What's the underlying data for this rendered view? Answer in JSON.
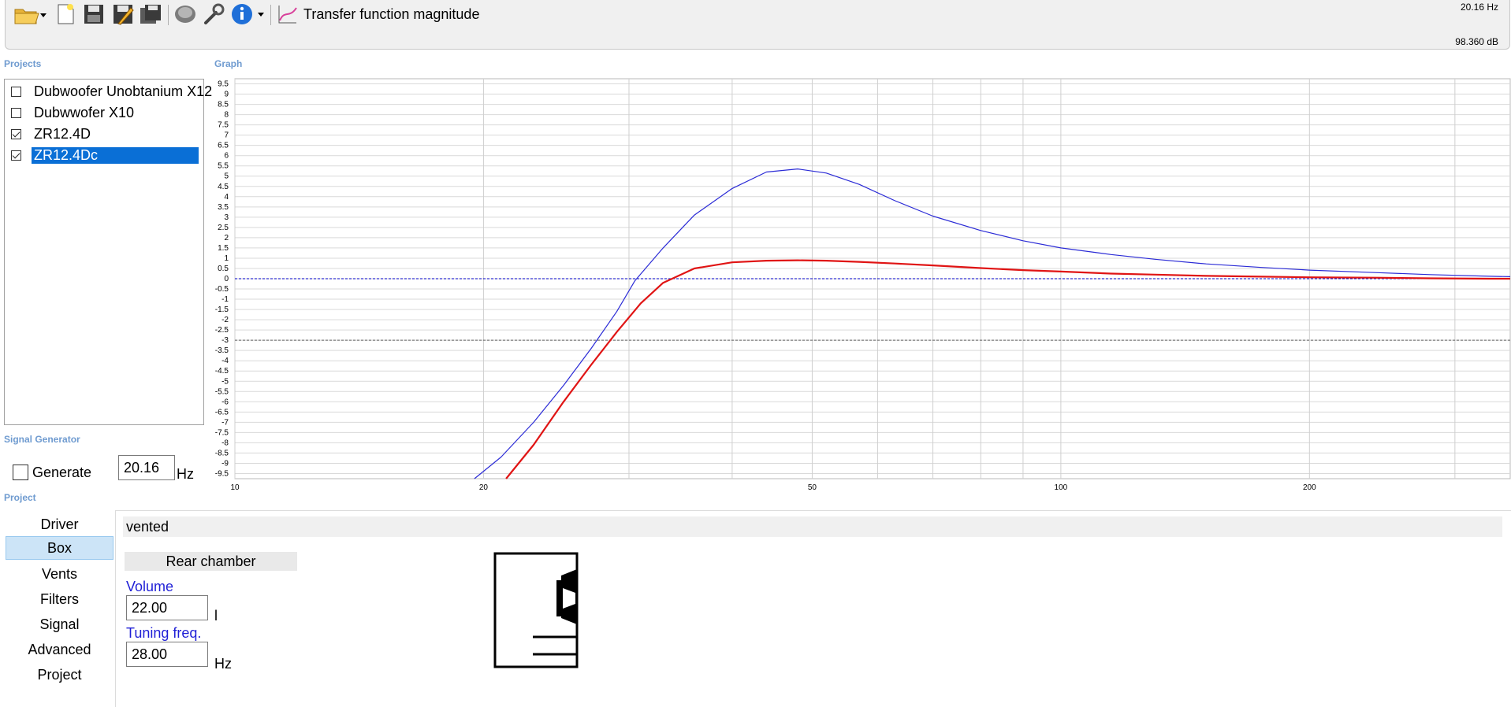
{
  "toolbar": {
    "buttons": [
      {
        "name": "open-folder-icon",
        "dropdown": true
      },
      {
        "name": "new-file-icon"
      },
      {
        "name": "save-icon"
      },
      {
        "name": "save-as-icon"
      },
      {
        "name": "save-all-icon"
      },
      {
        "name": "speaker-icon"
      },
      {
        "name": "wrench-icon"
      },
      {
        "name": "info-icon",
        "dropdown": true
      },
      {
        "name": "chart-icon"
      }
    ],
    "chart_title": "Transfer function magnitude",
    "freq_readout": "20.16 Hz",
    "db_readout": "98.360 dB"
  },
  "projects": {
    "title": "Projects",
    "items": [
      {
        "label": "Dubwoofer Unobtanium X12",
        "checked": false,
        "selected": false
      },
      {
        "label": "Dubwwofer X10",
        "checked": false,
        "selected": false
      },
      {
        "label": "ZR12.4D",
        "checked": true,
        "selected": false
      },
      {
        "label": "ZR12.4Dc",
        "checked": true,
        "selected": true
      }
    ]
  },
  "graph": {
    "title": "Graph"
  },
  "signal_generator": {
    "title": "Signal Generator",
    "generate_label": "Generate",
    "generate_checked": false,
    "frequency_value": "20.16",
    "frequency_unit": "Hz"
  },
  "project": {
    "title": "Project",
    "nav": [
      "Driver",
      "Box",
      "Vents",
      "Filters",
      "Signal",
      "Advanced",
      "Project"
    ],
    "selected_nav": "Box",
    "box_type": "vented",
    "rear_chamber_label": "Rear chamber",
    "volume_label": "Volume",
    "volume_value": "22.00",
    "volume_unit": "l",
    "tuning_label": "Tuning freq.",
    "tuning_value": "28.00",
    "tuning_unit": "Hz"
  },
  "chart_data": {
    "type": "line",
    "title": "",
    "xlabel": "",
    "ylabel": "",
    "x_scale": "log",
    "xlim": [
      10,
      350
    ],
    "ylim": [
      -9.75,
      9.75
    ],
    "x_tick_labels": [
      "10",
      "20",
      "50",
      "100",
      "200"
    ],
    "x_ticks": [
      10,
      20,
      50,
      100,
      200
    ],
    "y_ticks": [
      9.5,
      9,
      8.5,
      8,
      7.5,
      7,
      6.5,
      6,
      5.5,
      5,
      4.5,
      4,
      3.5,
      3,
      2.5,
      2,
      1.5,
      1,
      0.5,
      0,
      -0.5,
      -1,
      -1.5,
      -2,
      -2.5,
      -3,
      -3.5,
      -4,
      -4.5,
      -5,
      -5.5,
      -6,
      -6.5,
      -7,
      -7.5,
      -8,
      -8.5,
      -9,
      -9.5
    ],
    "y_tick_labels": [
      "9.5",
      "9",
      "8.5",
      "8",
      "7.5",
      "7",
      "6.5",
      "6",
      "5.5",
      "5",
      "4.5",
      "4",
      "3.5",
      "3",
      "2.5",
      "2",
      "1.5",
      "1",
      "0.5",
      "0",
      "-0.5",
      "-1",
      "-1.5",
      "-2",
      "-2.5",
      "-3",
      "-3.5",
      "-4",
      "-4.5",
      "-5",
      "-5.5",
      "-6",
      "-6.5",
      "-7",
      "-7.5",
      "-8",
      "-8.5",
      "-9",
      "-9.5"
    ],
    "grid": true,
    "reference_lines": [
      {
        "y": 0,
        "color": "#0000c8",
        "style": "dotted"
      },
      {
        "y": -3,
        "color": "#606060",
        "style": "dotted"
      }
    ],
    "series": [
      {
        "color": "#2b2bd6",
        "x": [
          19.5,
          21,
          23,
          25,
          27,
          29,
          30.5,
          33,
          36,
          40,
          44,
          48,
          52,
          57,
          63,
          70,
          80,
          90,
          100,
          115,
          130,
          150,
          175,
          200,
          240,
          280,
          330,
          350
        ],
        "y": [
          -10,
          -8.7,
          -7,
          -5.2,
          -3.4,
          -1.6,
          -0.1,
          1.5,
          3.1,
          4.4,
          5.2,
          5.35,
          5.15,
          4.6,
          3.8,
          3.05,
          2.35,
          1.85,
          1.5,
          1.18,
          0.95,
          0.72,
          0.55,
          0.42,
          0.3,
          0.2,
          0.12,
          0.1
        ]
      },
      {
        "color": "#e01414",
        "x": [
          21.3,
          23,
          25,
          27,
          29,
          31,
          33,
          36,
          40,
          44,
          48,
          52,
          57,
          63,
          70,
          80,
          90,
          100,
          115,
          130,
          150,
          175,
          200,
          240,
          280,
          330,
          350
        ],
        "y": [
          -10,
          -8.1,
          -6,
          -4.2,
          -2.6,
          -1.2,
          -0.2,
          0.5,
          0.8,
          0.88,
          0.9,
          0.88,
          0.82,
          0.74,
          0.65,
          0.52,
          0.42,
          0.35,
          0.25,
          0.2,
          0.14,
          0.1,
          0.07,
          0.05,
          0.02,
          0.0,
          0.0
        ]
      }
    ]
  }
}
